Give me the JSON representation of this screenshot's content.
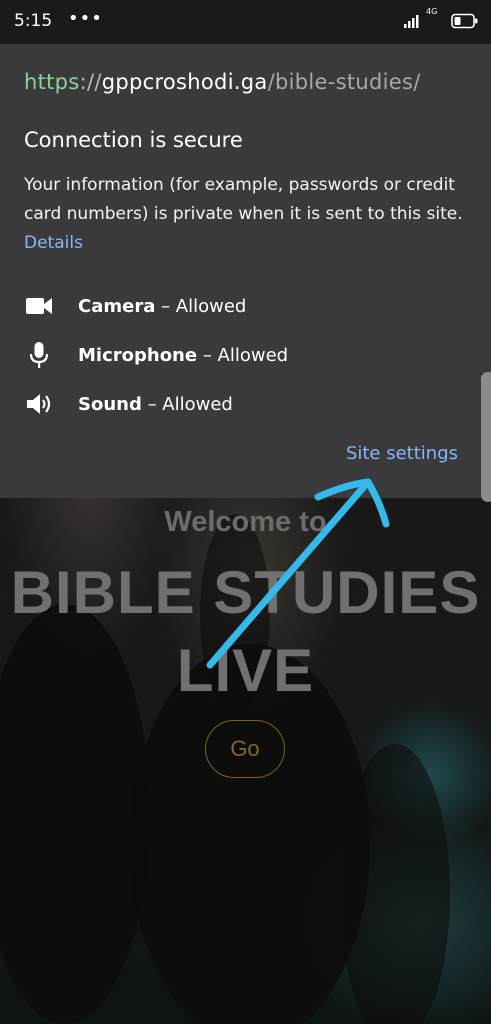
{
  "status_bar": {
    "time": "5:15",
    "dots": "•••",
    "network": "4G",
    "icons": [
      "signal-icon",
      "battery-icon"
    ]
  },
  "site_info": {
    "url": {
      "scheme": "https",
      "separator": "://",
      "host": "gppcroshodi.ga",
      "path": "/bible-studies/"
    },
    "heading": "Connection is secure",
    "description": "Your information (for example, passwords or credit card numbers) is private when it is sent to this site.",
    "details_link": "Details",
    "permissions": [
      {
        "name": "Camera",
        "status": "– Allowed",
        "icon": "camera-icon"
      },
      {
        "name": "Microphone",
        "status": "– Allowed",
        "icon": "microphone-icon"
      },
      {
        "name": "Sound",
        "status": "– Allowed",
        "icon": "speaker-icon"
      }
    ],
    "site_settings_link": "Site settings"
  },
  "webpage": {
    "welcome": "Welcome to",
    "title_line1": "BIBLE STUDIES",
    "title_line2": "LIVE",
    "go_button": "Go"
  },
  "colors": {
    "panel_bg": "#3a3a3d",
    "link": "#8ab4f8",
    "secure_scheme": "#8fd19e",
    "annotation": "#35b9ea",
    "go_border": "#7a6420"
  }
}
